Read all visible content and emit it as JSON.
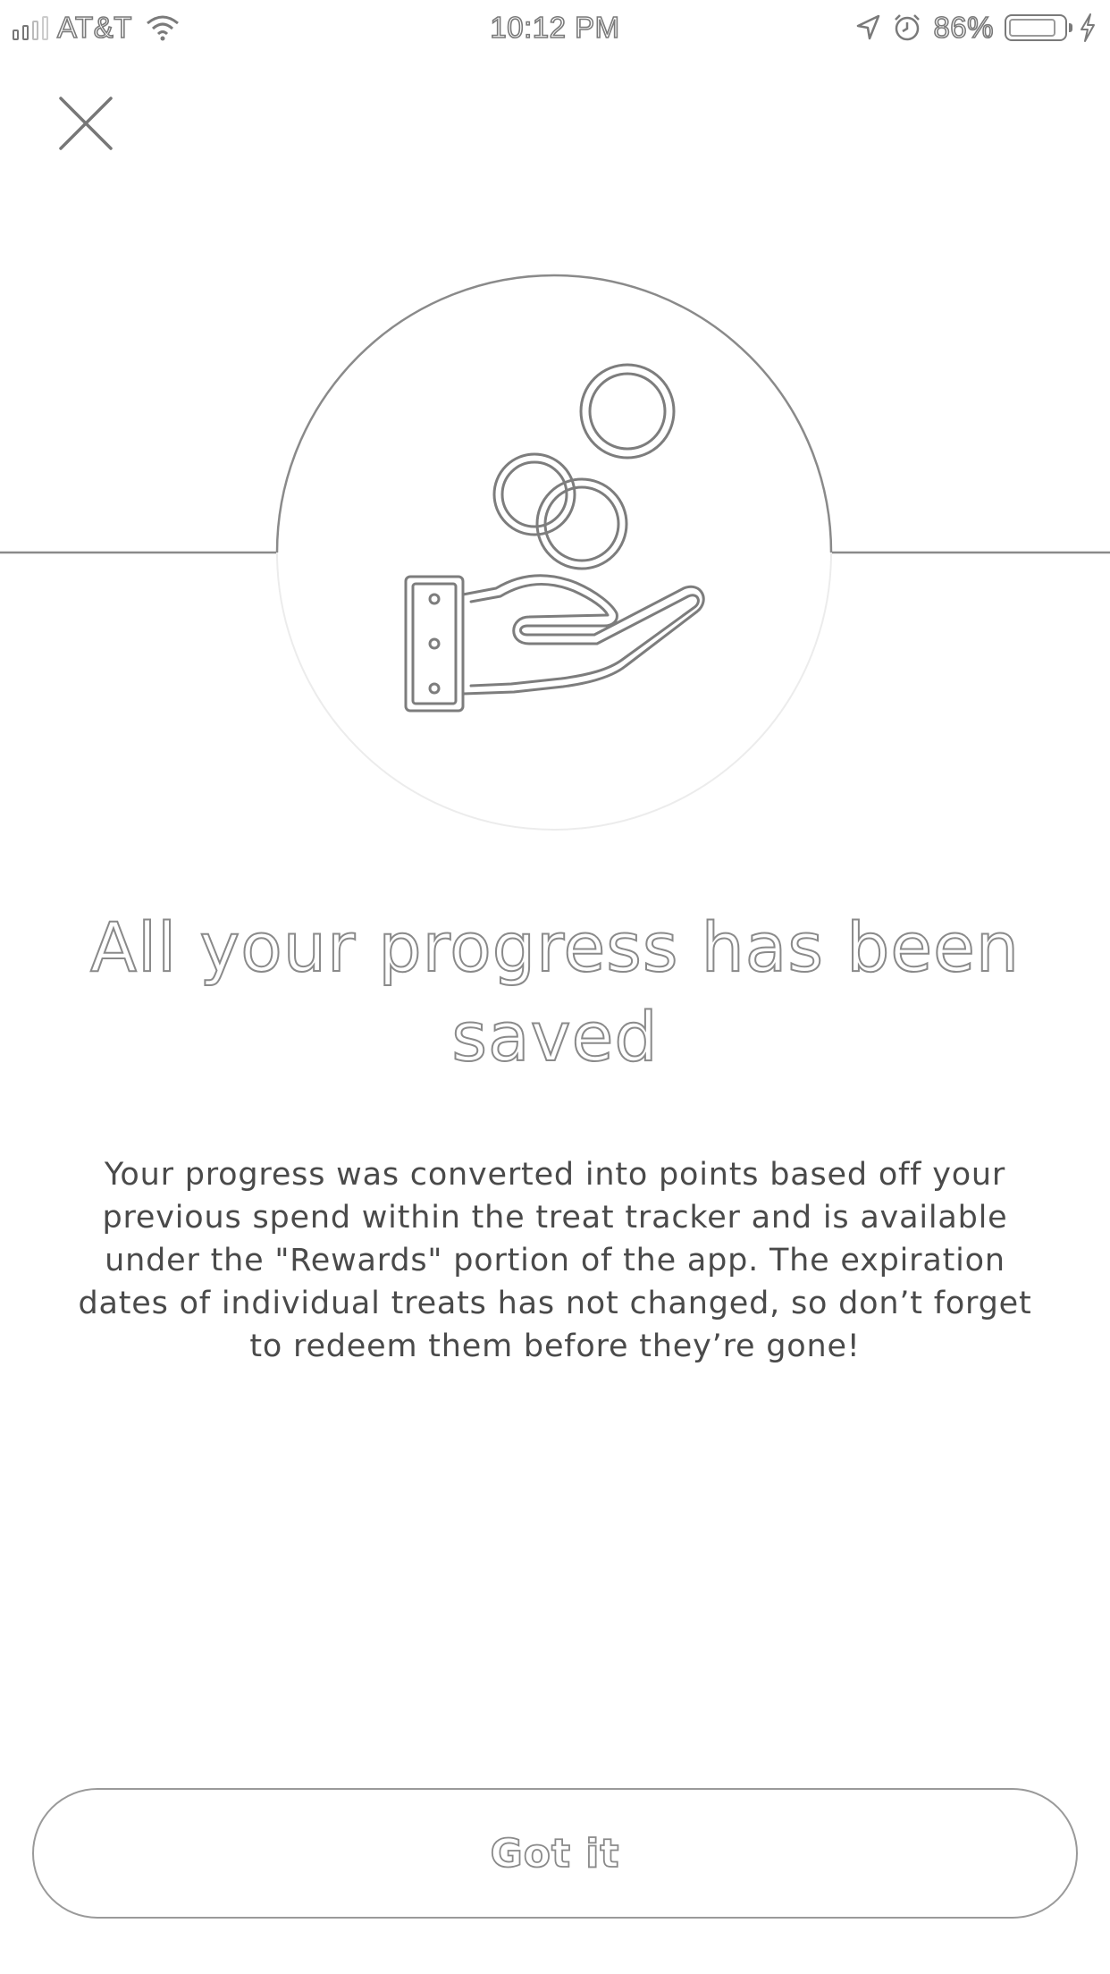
{
  "status_bar": {
    "carrier": "AT&T",
    "time": "10:12 PM",
    "battery_percent": "86%",
    "icons": [
      "signal-icon",
      "wifi-icon",
      "location-arrow-icon",
      "alarm-clock-icon",
      "battery-icon",
      "charging-bolt-icon"
    ]
  },
  "close": {
    "icon": "close-icon"
  },
  "hero": {
    "icon": "hand-receiving-coins-icon"
  },
  "content": {
    "title": "All your progress has been saved",
    "body": "Your progress was converted into points based off your previous spend within the treat tracker and is available under the \"Rewards\" portion of the app. The expiration dates of individual treats has not changed, so don’t forget to redeem them before they’re gone!"
  },
  "actions": {
    "confirm_label": "Got it"
  },
  "colors": {
    "background": "#ffffff",
    "line": "#8a8a8a",
    "text": "#4a4a4a"
  }
}
